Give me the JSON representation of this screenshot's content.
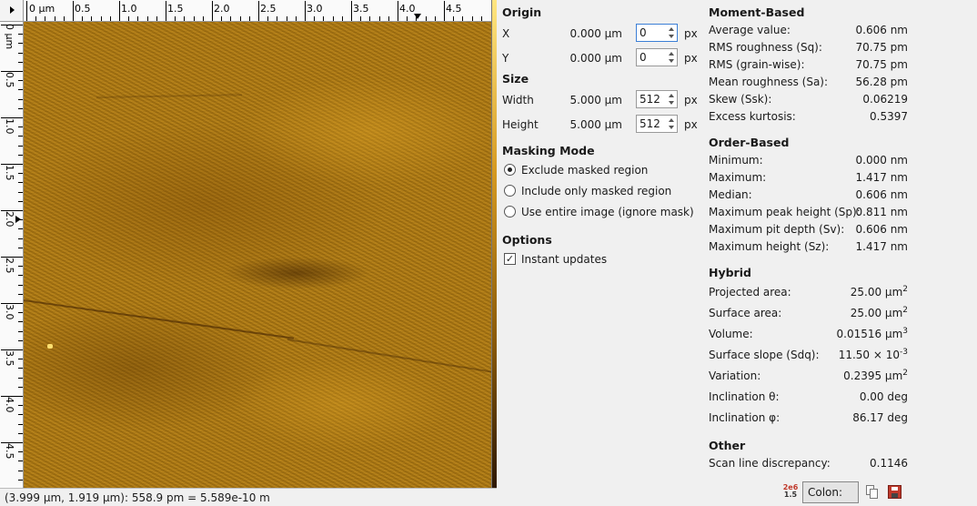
{
  "viewer": {
    "h_ruler_labels": [
      "0 μm",
      "0.5",
      "1.0",
      "1.5",
      "2.0",
      "2.5",
      "3.0",
      "3.5",
      "4.0",
      "4.5"
    ],
    "v_ruler_labels": [
      "0 μm",
      "0.5",
      "1.0",
      "1.5",
      "2.0",
      "2.5",
      "3.0",
      "3.5",
      "4.0",
      "4.5"
    ],
    "status_text": "(3.999 μm, 1.919 μm): 558.9 pm = 5.589e-10 m",
    "colormap": {
      "light": "#ffe680",
      "mid": "#b07a12",
      "dark": "#2e1800"
    }
  },
  "params": {
    "origin": {
      "title": "Origin",
      "x": {
        "label": "X",
        "value": "0.000 μm",
        "spin": "0",
        "unit": "px"
      },
      "y": {
        "label": "Y",
        "value": "0.000 μm",
        "spin": "0",
        "unit": "px"
      }
    },
    "size": {
      "title": "Size",
      "width": {
        "label": "Width",
        "value": "5.000 μm",
        "spin": "512",
        "unit": "px"
      },
      "height": {
        "label": "Height",
        "value": "5.000 μm",
        "spin": "512",
        "unit": "px"
      }
    },
    "masking": {
      "title": "Masking Mode",
      "options": [
        "Exclude masked region",
        "Include only masked region",
        "Use entire image (ignore mask)"
      ],
      "selected": 0
    },
    "options": {
      "title": "Options",
      "instant_updates": "Instant updates",
      "instant_checked": true
    }
  },
  "stats": {
    "moment": {
      "title": "Moment-Based",
      "rows": [
        {
          "label": "Average value:",
          "value": "0.606 nm"
        },
        {
          "label": "RMS roughness (Sq):",
          "value": "70.75 pm"
        },
        {
          "label": "RMS (grain-wise):",
          "value": "70.75 pm"
        },
        {
          "label": "Mean roughness (Sa):",
          "value": "56.28 pm"
        },
        {
          "label": "Skew (Ssk):",
          "value": "0.06219"
        },
        {
          "label": "Excess kurtosis:",
          "value": "0.5397"
        }
      ]
    },
    "order": {
      "title": "Order-Based",
      "rows": [
        {
          "label": "Minimum:",
          "value": "0.000 nm"
        },
        {
          "label": "Maximum:",
          "value": "1.417 nm"
        },
        {
          "label": "Median:",
          "value": "0.606 nm"
        },
        {
          "label": "Maximum peak height (Sp):",
          "value": "0.811 nm"
        },
        {
          "label": "Maximum pit depth (Sv):",
          "value": "0.606 nm"
        },
        {
          "label": "Maximum height (Sz):",
          "value": "1.417 nm"
        }
      ]
    },
    "hybrid": {
      "title": "Hybrid",
      "projected_label": "Projected area:",
      "projected_value": "25.00 μm",
      "projected_exp": "2",
      "surface_label": "Surface area:",
      "surface_value": "25.00 μm",
      "surface_exp": "2",
      "volume_label": "Volume:",
      "volume_value": "0.01516 μm",
      "volume_exp": "3",
      "slope_label": "Surface slope (Sdq):",
      "slope_value": "11.50 × 10",
      "slope_exp": "-3",
      "variation_label": "Variation:",
      "variation_value": "0.2395 μm",
      "variation_exp": "2",
      "theta_label": "Inclination θ:",
      "theta_value": "0.00 deg",
      "phi_label": "Inclination φ:",
      "phi_value": "86.17 deg"
    },
    "other": {
      "title": "Other",
      "rows": [
        {
          "label": "Scan line discrepancy:",
          "value": "0.1146"
        }
      ]
    }
  },
  "bottom": {
    "format_icon_top": "2e6",
    "format_icon_bottom": "1.5",
    "separator_button": "Colon:"
  }
}
